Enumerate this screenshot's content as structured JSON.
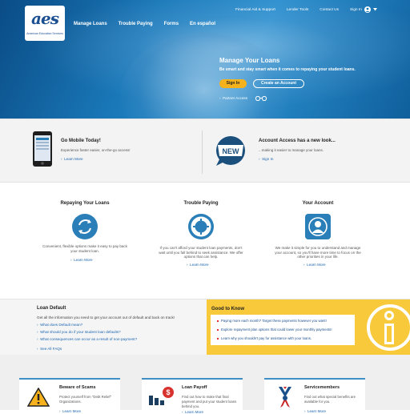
{
  "brand": {
    "logo_text": "aes",
    "logo_sub": "American Education Services"
  },
  "main_nav": [
    "Manage Loans",
    "Trouble Paying",
    "Forms",
    "En español"
  ],
  "util_nav": {
    "financial_aid": "Financial Aid & Support",
    "lender_tools": "Lender Tools",
    "contact": "Contact Us",
    "sign_in": "Sign In"
  },
  "hero": {
    "title": "Manage Your Loans",
    "subtitle": "Be smart and stay smart when it comes to repaying your student loans.",
    "sign_in_button": "Sign In",
    "create_account_button": "Create an Account",
    "partner_access": "Partner Access"
  },
  "promo": {
    "mobile": {
      "title": "Go Mobile Today!",
      "text": "Experience faster easier, on-the-go access!",
      "link": "Learn More"
    },
    "account": {
      "title": "Account Access has a new look...",
      "text": "...making it easier to manage your loans.",
      "link": "Sign In",
      "badge": "NEW"
    }
  },
  "services": [
    {
      "title": "Repaying Your Loans",
      "text": [
        "Convenient, flexible options make it easy to pay back",
        "your student loan."
      ],
      "link": "Learn More"
    },
    {
      "title": "Trouble Paying",
      "text": [
        "If you can't afford your student loan payments, don't",
        "wait until you fall behind to seek assistance. We offer",
        "options that can help."
      ],
      "link": "Learn More"
    },
    {
      "title": "Your Account",
      "text": [
        "We make it simple for you to understand and manage",
        "your account, so you'll have more time to focus on the",
        "other priorities in your life."
      ],
      "link": "Learn More"
    }
  ],
  "loan_default": {
    "title": "Loan Default",
    "text": "Get all the information you need to get your account out of default and back on track!",
    "questions": [
      "What does Default mean?",
      "What should you do if your student loan defaults?",
      "What consequences can occur as a result of non-payment?"
    ],
    "see_all": "See All FAQs"
  },
  "good_to_know": {
    "title": "Good to Know",
    "items": [
      "Paying more each month? Target these payments however you want!",
      "Explore repayment plan options that could lower your monthly payments!",
      "Learn why you shouldn't pay for assistance with your loans."
    ]
  },
  "cards": [
    {
      "title": "Beware of Scams",
      "text": [
        "Protect yourself from \"Debt Relief\"",
        "Organizations."
      ],
      "link": "Learn More"
    },
    {
      "title": "Loan Payoff",
      "text": [
        "Find out how to make that final",
        "payment and put your student loans",
        "behind you."
      ],
      "link": "Learn More"
    },
    {
      "title": "Servicemembers",
      "text": [
        "Find out what special benefits are",
        "available for you."
      ],
      "link": "Learn More"
    }
  ],
  "colors": {
    "hero_blue": "#1a78b8",
    "accent_yellow": "#f5b21d",
    "link_blue": "#1b65b0",
    "good_to_know_bg": "#f8c93a"
  }
}
